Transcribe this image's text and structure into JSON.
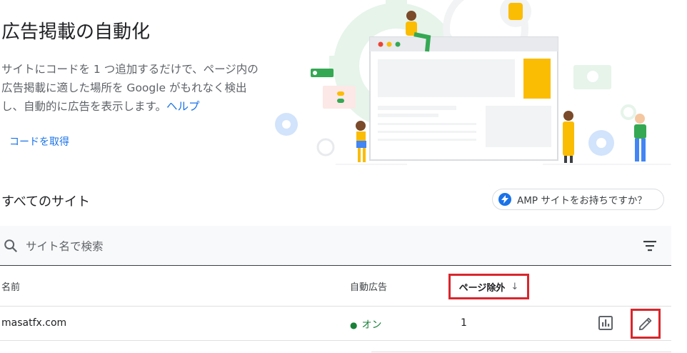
{
  "header": {
    "title": "広告掲載の自動化",
    "description": "サイトにコードを 1 つ追加するだけで、ページ内の広告掲載に適した場所を Google がもれなく検出し、自動的に広告を表示します。",
    "help_link": "ヘルプ",
    "get_code_link": "コードを取得"
  },
  "sites": {
    "section_title": "すべてのサイト",
    "amp_chip_label": "AMP サイトをお持ちですか？",
    "search": {
      "placeholder": "サイト名で検索",
      "value": ""
    },
    "columns": {
      "name": "名前",
      "auto_ads": "自動広告",
      "excluded_pages": "ページ除外",
      "sort_arrow": "↓"
    },
    "rows": [
      {
        "name": "masatfx.com",
        "auto_ads": "オン",
        "status_dot": "●",
        "excluded_pages": "1"
      }
    ]
  },
  "icons": {
    "search": "search-icon",
    "filter": "filter-icon",
    "amp": "lightning-bolt-icon",
    "report": "bar-chart-icon",
    "edit": "pencil-icon"
  },
  "colors": {
    "link": "#1a73e8",
    "status_on": "#188038",
    "highlight_box": "#d9262c",
    "accent_yellow": "#fbbc04",
    "illustration_green": "#e6f4ea"
  }
}
